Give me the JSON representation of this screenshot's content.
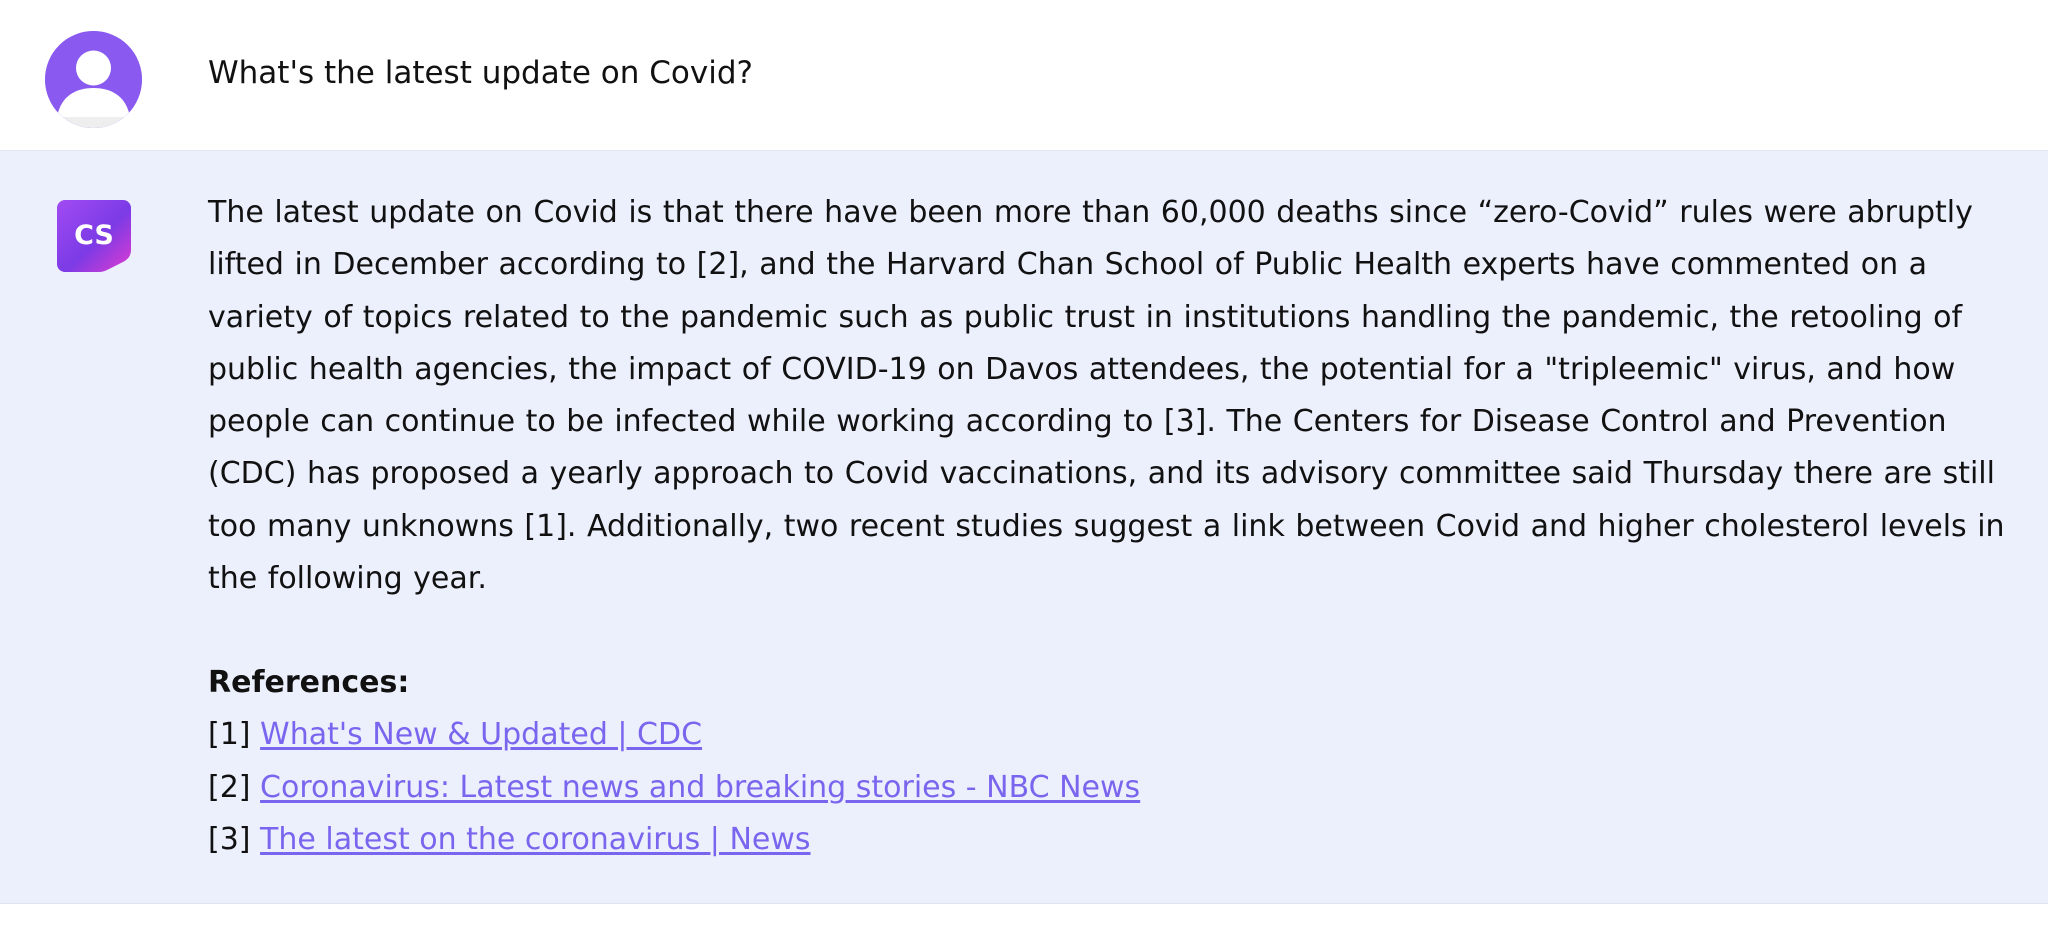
{
  "user_message": {
    "avatar_icon": "user-icon",
    "avatar_color": "#8a5af0",
    "text": "What's the latest update on Covid?"
  },
  "bot_message": {
    "avatar_icon": "cs-logo",
    "avatar_text": "CS",
    "answer_lines": [
      "The latest update on Covid is that there have been more than 60,000 deaths since “zero-Covid” rules were abruptly",
      "lifted in December according to [2], and the Harvard Chan School of Public Health experts have commented on a",
      "variety of topics related to the pandemic such as public trust in institutions handling the pandemic, the retooling of",
      "public health agencies, the impact of COVID-19 on Davos attendees, the potential for a \"tripleemic\" virus, and how",
      "people can continue to be infected while working according to [3]. The Centers for Disease Control and Prevention",
      "(CDC) has proposed a yearly approach to Covid vaccinations, and its advisory committee said Thursday there are still",
      "too many unknowns [1]. Additionally, two recent studies suggest a link between Covid and higher cholesterol levels in",
      "the following year."
    ],
    "references_heading": "References:",
    "references": [
      {
        "index": "[1]",
        "title": "What's New & Updated | CDC"
      },
      {
        "index": "[2]",
        "title": "Coronavirus: Latest news and breaking stories - NBC News"
      },
      {
        "index": "[3]",
        "title": "The latest on the coronavirus | News"
      }
    ]
  },
  "colors": {
    "bot_background": "#eceffc",
    "link": "#7a66ee"
  }
}
